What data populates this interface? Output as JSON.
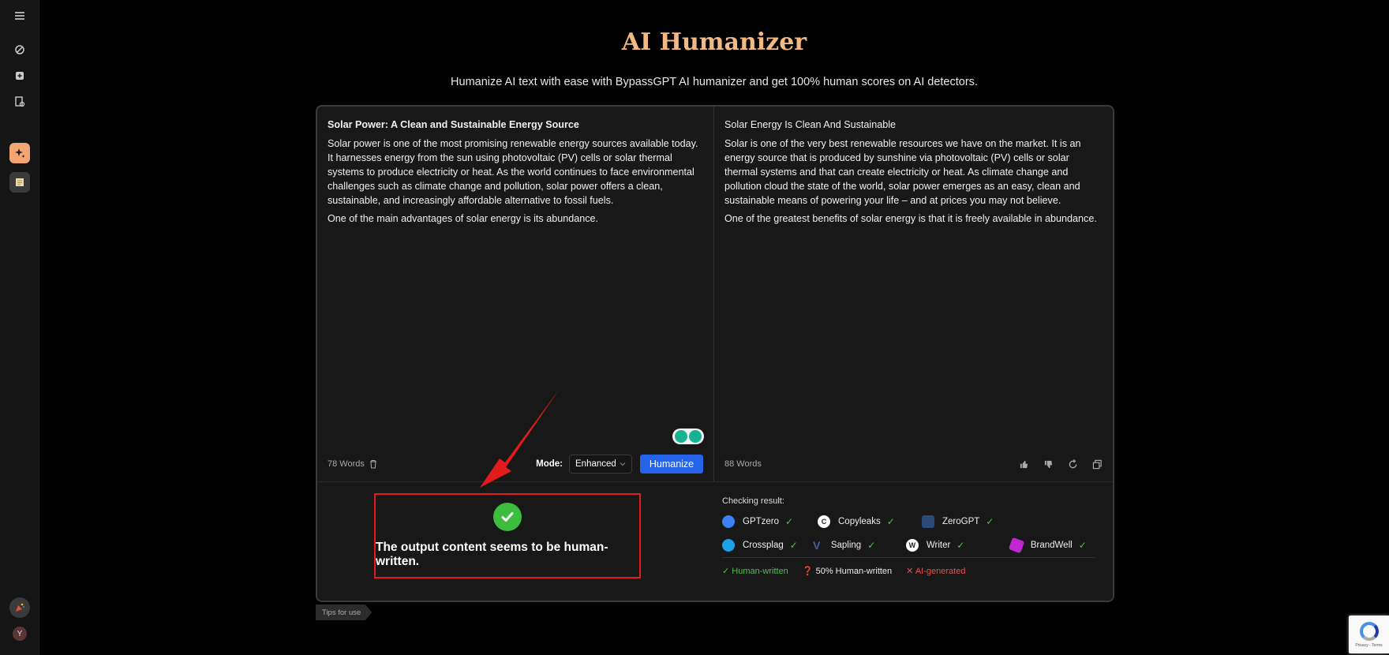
{
  "page": {
    "title": "AI Humanizer",
    "subtitle": "Humanize AI text with ease with BypassGPT AI humanizer and get 100% human scores on AI detectors."
  },
  "sidebar": {
    "avatar_letter": "Y"
  },
  "input": {
    "heading": "Solar Power: A Clean and Sustainable Energy Source",
    "p1": "Solar power is one of the most promising renewable energy sources available today. It harnesses energy from the sun using photovoltaic (PV) cells or solar thermal systems to produce electricity or heat. As the world continues to face environmental challenges such as climate change and pollution, solar power offers a clean, sustainable, and increasingly affordable alternative to fossil fuels.",
    "p2": "One of the main advantages of solar energy is its abundance.",
    "word_count": "78 Words",
    "mode_label": "Mode:",
    "mode_value": "Enhanced",
    "humanize_label": "Humanize"
  },
  "output": {
    "heading": "Solar Energy  Is Clean And Sustainable",
    "p1": "Solar is one of the very best renewable resources we have on the  market. It is an energy source that is produced by sunshine via photovoltaic (PV) cells or solar thermal systems and that can  create electricity or heat. As climate change and pollution cloud the state of the world, solar power emerges  as an easy, clean and sustainable means of powering your life – and at prices you may not believe.",
    "p2": "One of  the greatest benefits of solar energy is that it is freely available in abundance.",
    "word_count": "88 Words"
  },
  "result": {
    "message": "The output content seems to be human-written."
  },
  "checking": {
    "title": "Checking result:",
    "detectors": [
      {
        "name": "GPTzero",
        "color": "#3b82f6"
      },
      {
        "name": "Copyleaks",
        "color": "#ffffff"
      },
      {
        "name": "ZeroGPT",
        "color": "#2a4a7a"
      },
      {
        "name": "Crossplag",
        "color": "#1ea0e6"
      },
      {
        "name": "Sapling",
        "color": "#4a5fa8"
      },
      {
        "name": "Writer",
        "color": "#ffffff"
      },
      {
        "name": "BrandWell",
        "color": "#c026d3"
      }
    ],
    "legend": {
      "human": "Human-written",
      "half": "50% Human-written",
      "ai": "AI-generated"
    }
  },
  "tips_label": "Tips for use",
  "recaptcha_text": "Privacy - Terms"
}
